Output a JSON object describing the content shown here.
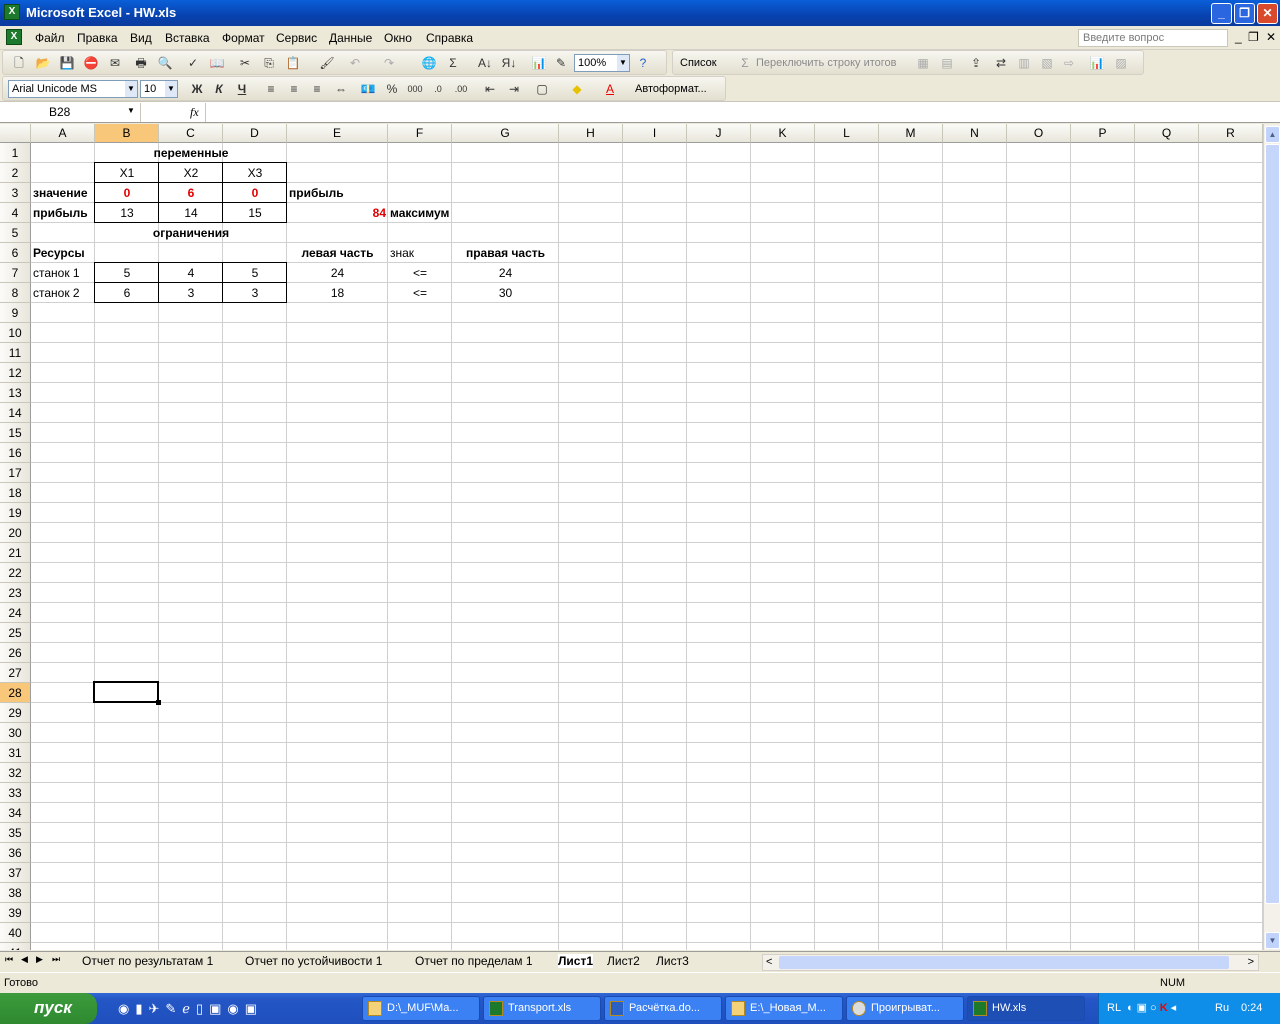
{
  "window": {
    "title": "Microsoft Excel - HW.xls",
    "min": "_",
    "restore": "❐",
    "close": "✕"
  },
  "menu": {
    "items": [
      "Файл",
      "Правка",
      "Вид",
      "Вставка",
      "Формат",
      "Сервис",
      "Данные",
      "Окно",
      "Справка"
    ],
    "help_placeholder": "Введите вопрос"
  },
  "toolbar": {
    "zoom": "100%",
    "list_label": "Список",
    "totals_label": "Переключить строку итогов",
    "font": "Arial Unicode MS",
    "size": "10",
    "bold": "Ж",
    "italic": "К",
    "underline": "Ч",
    "percent": "%",
    "thousands": "000",
    "autoformat": "Автоформат..."
  },
  "formula_bar": {
    "name_box": "B28",
    "fx": "fx",
    "value": ""
  },
  "columns": [
    "A",
    "B",
    "C",
    "D",
    "E",
    "F",
    "G",
    "H",
    "I",
    "J",
    "K",
    "L",
    "M",
    "N",
    "O",
    "P",
    "Q",
    "R"
  ],
  "selected": {
    "col": "B",
    "row": 28
  },
  "cells": {
    "B1": "переменные",
    "B2": "X1",
    "C2": "X2",
    "D2": "X3",
    "A3": "значение",
    "B3": "0",
    "C3": "6",
    "D3": "0",
    "E3": "прибыль",
    "A4": "прибыль",
    "B4": "13",
    "C4": "14",
    "D4": "15",
    "E4": "84",
    "F4": "максимум",
    "B5": "ограничения",
    "A6": "Ресурсы",
    "E6": "левая часть",
    "F6": "знак",
    "G6": "правая часть",
    "A7": "станок 1",
    "B7": "5",
    "C7": "4",
    "D7": "5",
    "E7": "24",
    "F7": "<=",
    "G7": "24",
    "A8": "станок 2",
    "B8": "6",
    "C8": "3",
    "D8": "3",
    "E8": "18",
    "F8": "<=",
    "G8": "30"
  },
  "sheets": [
    "Отчет по результатам 1",
    "Отчет по устойчивости 1",
    "Отчет по пределам 1",
    "Лист1",
    "Лист2",
    "Лист3"
  ],
  "active_sheet": "Лист1",
  "status": {
    "text": "Готово",
    "num": "NUM"
  },
  "taskbar": {
    "start": "пуск",
    "tasks": [
      "D:\\_MUF\\Ma...",
      "Transport.xls",
      "Расчётка.do...",
      "E:\\_Новая_М...",
      "Проигрыват...",
      "HW.xls"
    ],
    "active_task": "HW.xls",
    "lang": "RL",
    "kb": "Ru",
    "clock": "0:24"
  },
  "colors": {
    "accent": "#f8c77a",
    "value_red": "#e00000"
  }
}
